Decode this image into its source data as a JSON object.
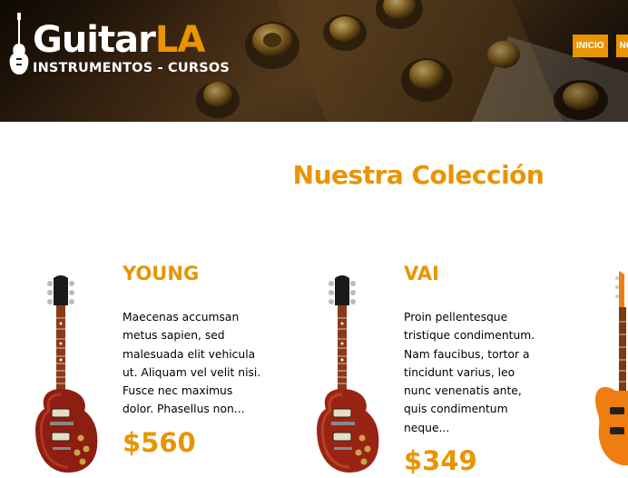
{
  "header": {
    "logo": {
      "name_main": "Guitar",
      "name_accent": "LA",
      "tagline": "INSTRUMENTOS - CURSOS"
    },
    "nav": [
      {
        "label": "Inicio"
      },
      {
        "label": "Nosotros"
      }
    ]
  },
  "main": {
    "title": "Nuestra Colección",
    "products": [
      {
        "name": "YOUNG",
        "description": "Maecenas accumsan metus sapien, sed malesuada elit vehicula ut. Aliquam vel velit nisi. Fusce nec maximus dolor. Phasellus non...",
        "price": "$560",
        "guitar_color": "#8e1d12",
        "image_icon": "guitar-image"
      },
      {
        "name": "VAI",
        "description": "Proin pellentesque tristique condimentum. Nam faucibus, tortor a tincidunt varius, leo nunc venenatis ante, quis condimentum neque...",
        "price": "$349",
        "guitar_color": "#9a2414",
        "image_icon": "guitar-image"
      }
    ],
    "partial_product": {
      "guitar_color": "#ef7d0f",
      "image_icon": "guitar-image"
    }
  },
  "colors": {
    "accent": "#e99401",
    "header_dark": "#2b1a0c",
    "text": "#000000"
  }
}
